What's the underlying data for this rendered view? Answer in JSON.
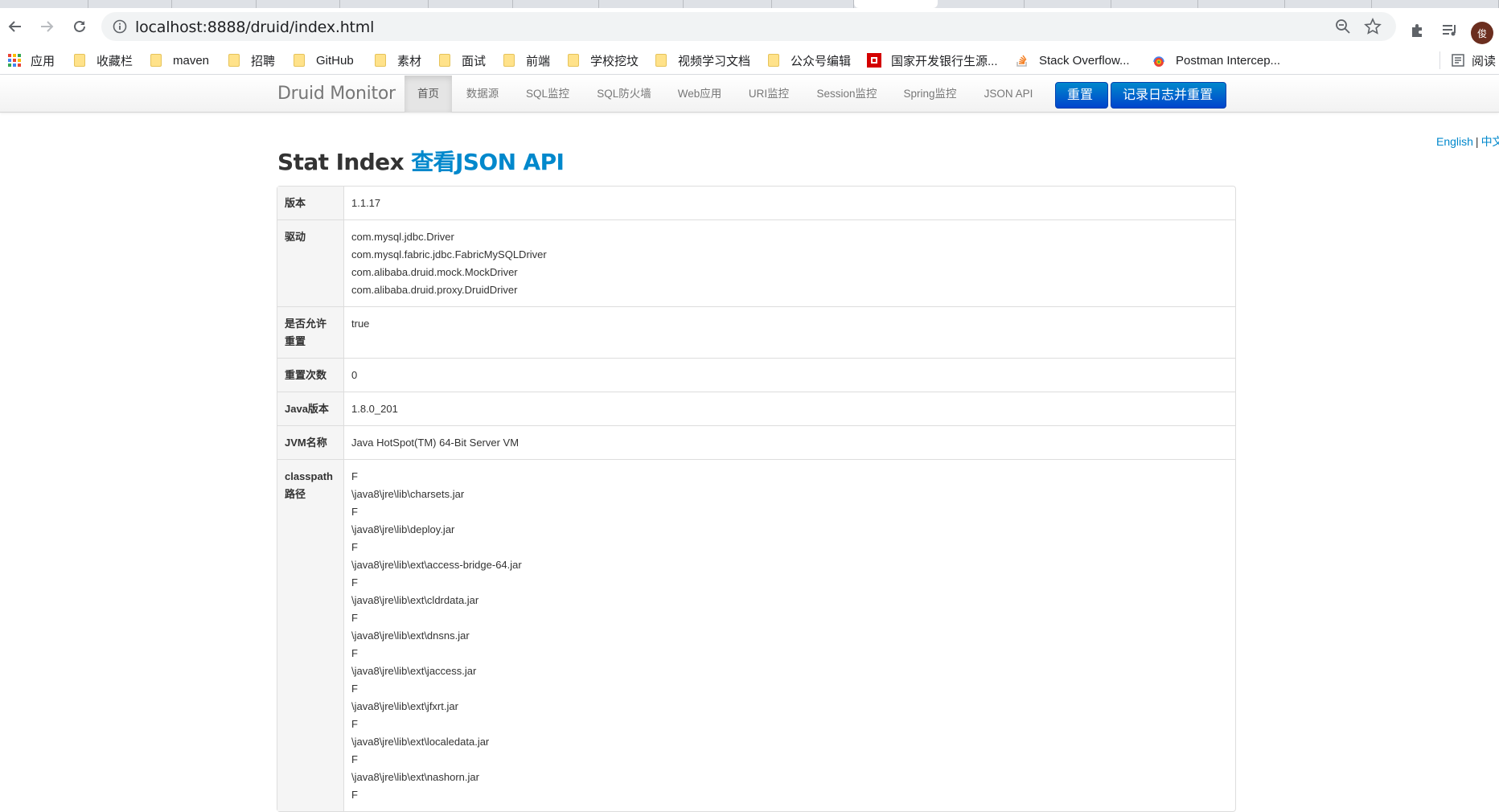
{
  "browser": {
    "url": "localhost:8888/druid/index.html",
    "avatar_text": "俊",
    "bookmarks": [
      {
        "label": "应用",
        "kind": "apps"
      },
      {
        "label": "收藏栏",
        "kind": "folder"
      },
      {
        "label": "maven",
        "kind": "folder"
      },
      {
        "label": "招聘",
        "kind": "folder"
      },
      {
        "label": "GitHub",
        "kind": "folder"
      },
      {
        "label": "素材",
        "kind": "folder"
      },
      {
        "label": "面试",
        "kind": "folder"
      },
      {
        "label": "前端",
        "kind": "folder"
      },
      {
        "label": "学校挖坟",
        "kind": "folder"
      },
      {
        "label": "视频学习文档",
        "kind": "folder"
      },
      {
        "label": "公众号编辑",
        "kind": "folder"
      },
      {
        "label": "国家开发银行生源...",
        "kind": "site"
      },
      {
        "label": "Stack Overflow...",
        "kind": "site"
      },
      {
        "label": "Postman Intercep...",
        "kind": "site"
      }
    ],
    "reading_list": "阅读"
  },
  "navbar": {
    "brand": "Druid Monitor",
    "items": [
      "首页",
      "数据源",
      "SQL监控",
      "SQL防火墙",
      "Web应用",
      "URI监控",
      "Session监控",
      "Spring监控",
      "JSON API"
    ],
    "active_index": 0,
    "reset_button": "重置",
    "log_reset_button": "记录日志并重置"
  },
  "lang": {
    "english": "English",
    "sep": "|",
    "chinese": "中文"
  },
  "page": {
    "title": "Stat Index",
    "title_link": "查看JSON API"
  },
  "rows": [
    {
      "key": "版本",
      "values": [
        "1.1.17"
      ]
    },
    {
      "key": "驱动",
      "values": [
        "com.mysql.jdbc.Driver",
        "com.mysql.fabric.jdbc.FabricMySQLDriver",
        "com.alibaba.druid.mock.MockDriver",
        "com.alibaba.druid.proxy.DruidDriver"
      ]
    },
    {
      "key": "是否允许重置",
      "values": [
        "true"
      ]
    },
    {
      "key": "重置次数",
      "values": [
        "0"
      ]
    },
    {
      "key": "Java版本",
      "values": [
        "1.8.0_201"
      ]
    },
    {
      "key": "JVM名称",
      "values": [
        "Java HotSpot(TM) 64-Bit Server VM"
      ]
    },
    {
      "key": "classpath路径",
      "values": [
        "F",
        "\\java8\\jre\\lib\\charsets.jar",
        "F",
        "\\java8\\jre\\lib\\deploy.jar",
        "F",
        "\\java8\\jre\\lib\\ext\\access-bridge-64.jar",
        "F",
        "\\java8\\jre\\lib\\ext\\cldrdata.jar",
        "F",
        "\\java8\\jre\\lib\\ext\\dnsns.jar",
        "F",
        "\\java8\\jre\\lib\\ext\\jaccess.jar",
        "F",
        "\\java8\\jre\\lib\\ext\\jfxrt.jar",
        "F",
        "\\java8\\jre\\lib\\ext\\localedata.jar",
        "F",
        "\\java8\\jre\\lib\\ext\\nashorn.jar",
        "F"
      ]
    }
  ]
}
